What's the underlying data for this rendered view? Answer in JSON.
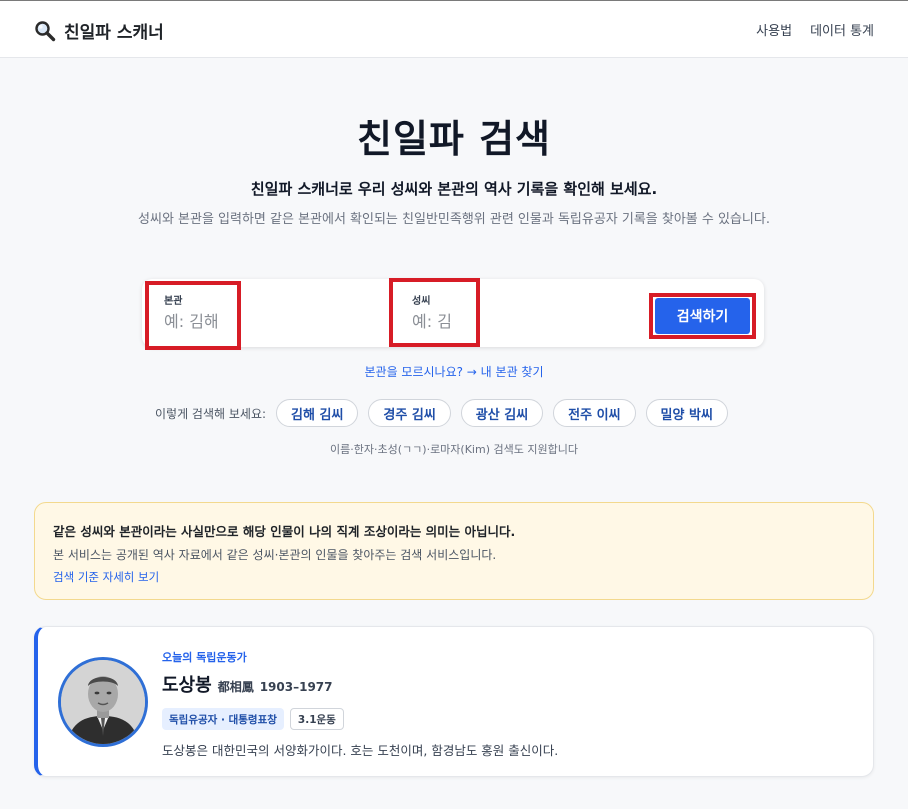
{
  "header": {
    "brand_name": "친일파 스캐너",
    "nav": [
      "사용법",
      "데이터 통계"
    ]
  },
  "hero": {
    "title": "친일파 검색",
    "subtitle": "친일파 스캐너로 우리 성씨와 본관의 역사 기록을 확인해 보세요.",
    "description": "성씨와 본관을 입력하면 같은 본관에서 확인되는 친일반민족행위 관련 인물과 독립유공자 기록을 찾아볼 수 있습니다."
  },
  "search": {
    "bongwan_label": "본관",
    "bongwan_placeholder": "예: 김해",
    "bongwan_value": "",
    "seongssi_label": "성씨",
    "seongssi_placeholder": "예: 김",
    "seongssi_value": "",
    "button_label": "검색하기",
    "find_link": "본관을 모르시나요? → 내 본관 찾기",
    "examples_label": "이렇게 검색해 보세요:",
    "examples": [
      "김해 김씨",
      "경주 김씨",
      "광산 김씨",
      "전주 이씨",
      "밀양 박씨"
    ],
    "support_note": "이름·한자·초성(ㄱㄱ)·로마자(Kim) 검색도 지원합니다"
  },
  "notice": {
    "title": "같은 성씨와 본관이라는 사실만으로 해당 인물이 나의 직계 조상이라는 의미는 아닙니다.",
    "body": "본 서비스는 공개된 역사 자료에서 같은 성씨·본관의 인물을 찾아주는 검색 서비스입니다.",
    "link": "검색 기준 자세히 보기"
  },
  "featured": {
    "kicker": "오늘의 독립운동가",
    "name": "도상봉",
    "hanja": "都相鳳",
    "years": "1903–1977",
    "badges": [
      "독립유공자 · 대통령표창",
      "3.1운동"
    ],
    "description": "도상봉은 대한민국의 서양화가이다. 호는 도천이며, 함경남도 홍원 출신이다."
  },
  "colors": {
    "accent": "#2563eb",
    "highlight": "#d71c26",
    "notice_bg": "#fff8e6"
  },
  "icons": {
    "brand": "magnifier-icon"
  }
}
